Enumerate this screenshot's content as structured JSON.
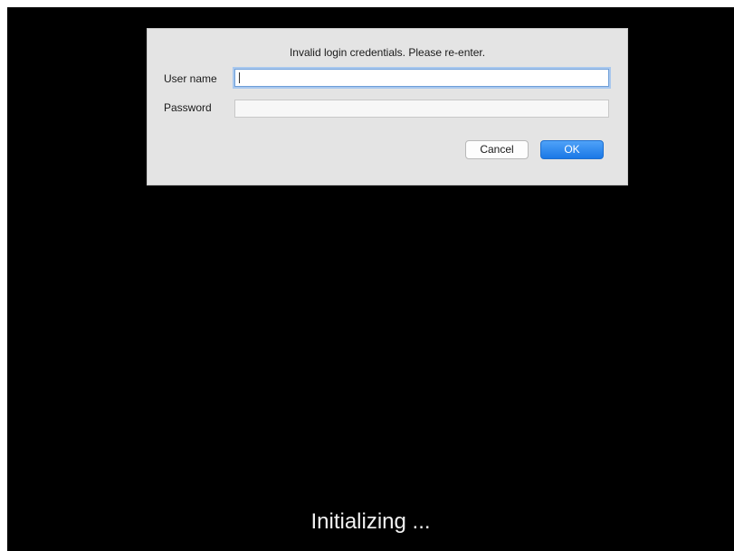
{
  "dialog": {
    "message": "Invalid login credentials. Please re-enter.",
    "username_label": "User name",
    "username_value": "",
    "password_label": "Password",
    "password_value": "",
    "cancel_label": "Cancel",
    "ok_label": "OK"
  },
  "status": {
    "text": "Initializing ..."
  },
  "colors": {
    "screen_background": "#000000",
    "dialog_background": "#e4e4e4",
    "ok_button": "#1a78e6",
    "focus_ring": "#6f9fd8"
  }
}
